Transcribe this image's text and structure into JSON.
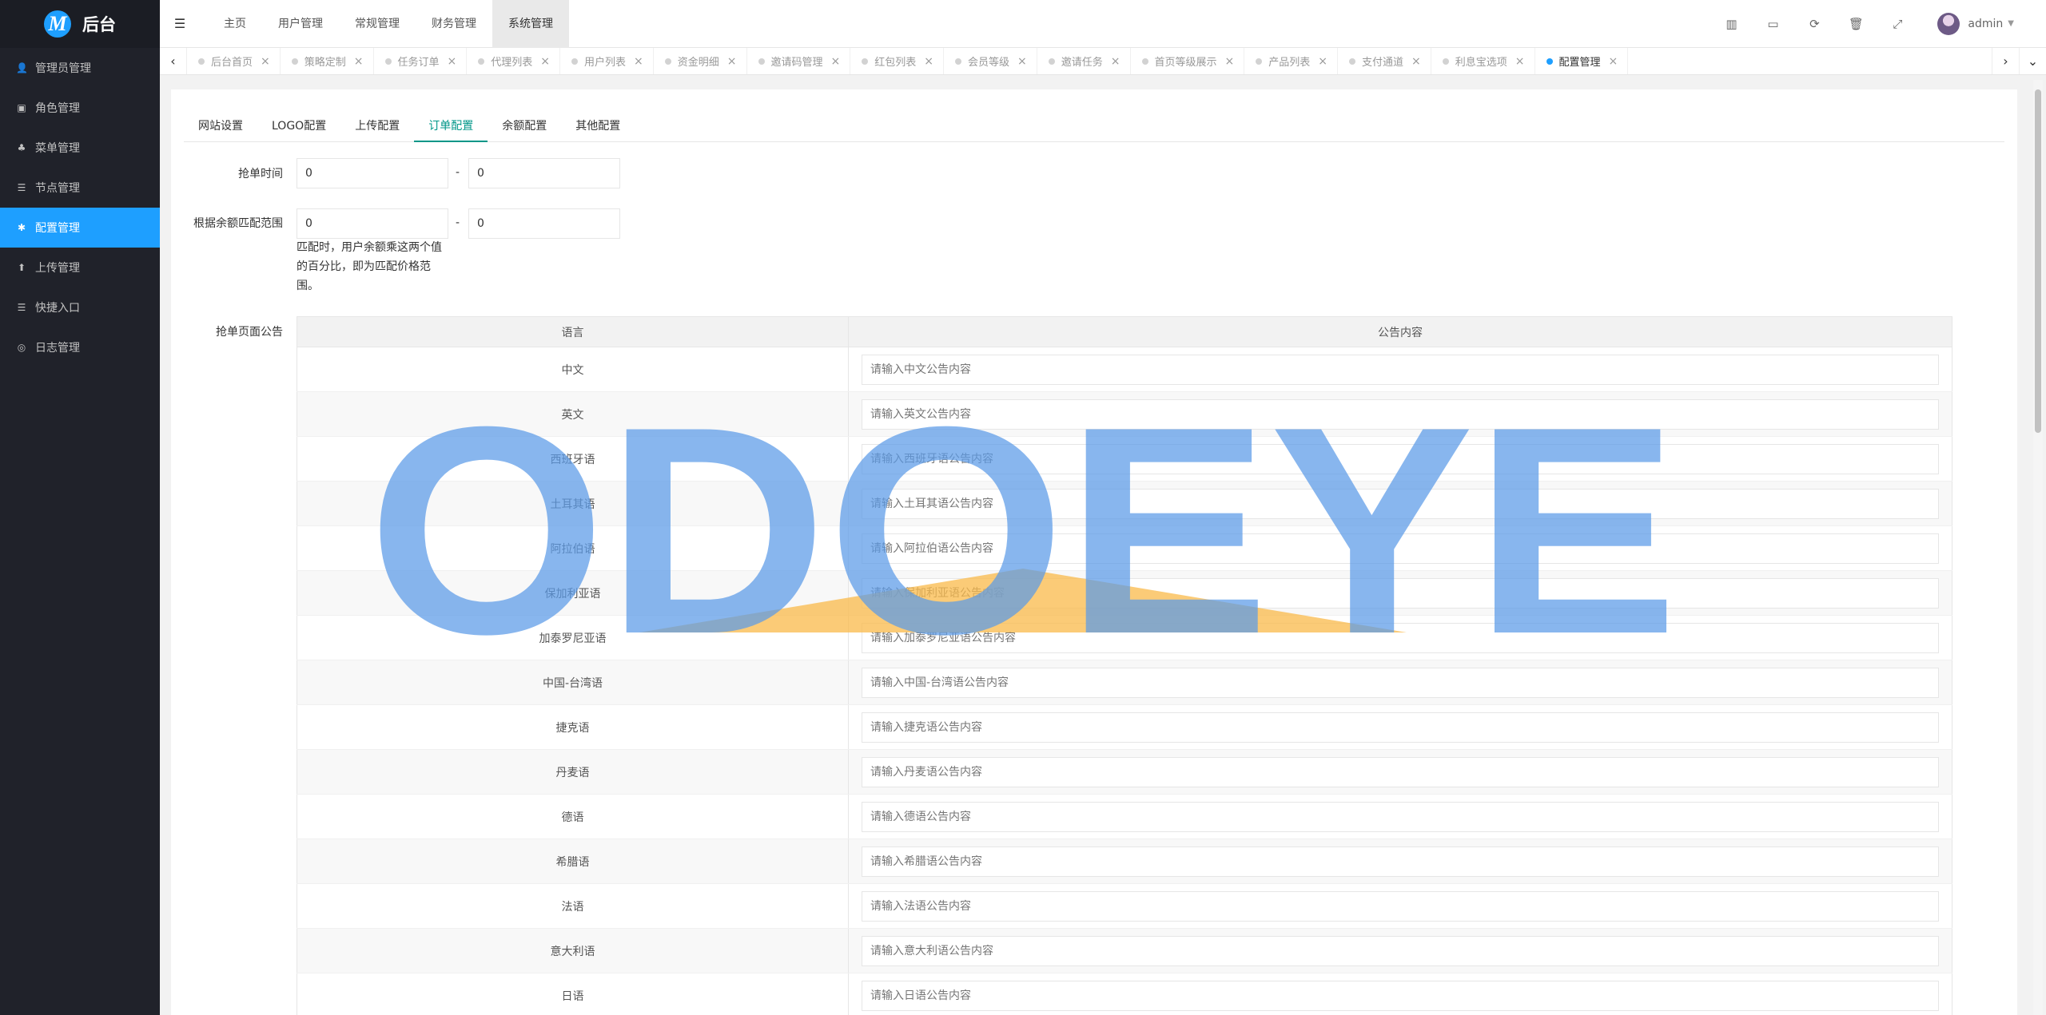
{
  "brand": {
    "logo_letter": "M",
    "name": "后台"
  },
  "sidebar": {
    "items": [
      {
        "icon": "user-icon",
        "glyph": "👤",
        "label": "管理员管理"
      },
      {
        "icon": "role-icon",
        "glyph": "▣",
        "label": "角色管理"
      },
      {
        "icon": "tree-icon",
        "glyph": "♣",
        "label": "菜单管理"
      },
      {
        "icon": "list-icon",
        "glyph": "☰",
        "label": "节点管理"
      },
      {
        "icon": "gear-icon",
        "glyph": "✱",
        "label": "配置管理"
      },
      {
        "icon": "upload-icon",
        "glyph": "⬆",
        "label": "上传管理"
      },
      {
        "icon": "list-icon",
        "glyph": "☰",
        "label": "快捷入口"
      },
      {
        "icon": "log-icon",
        "glyph": "◎",
        "label": "日志管理"
      }
    ],
    "active_index": 4
  },
  "header": {
    "toggle_glyph": "☰",
    "menu": [
      "主页",
      "用户管理",
      "常规管理",
      "财务管理",
      "系统管理"
    ],
    "active_menu": 4,
    "icons": [
      {
        "name": "chart-icon",
        "glyph": "▥"
      },
      {
        "name": "card-icon",
        "glyph": "▭"
      },
      {
        "name": "refresh-icon",
        "glyph": "⟳"
      },
      {
        "name": "trash-icon",
        "glyph": "🗑"
      },
      {
        "name": "fullscreen-icon",
        "glyph": "⤢"
      }
    ],
    "username": "admin"
  },
  "tabbar": {
    "tabs": [
      "后台首页",
      "策略定制",
      "任务订单",
      "代理列表",
      "用户列表",
      "资金明细",
      "邀请码管理",
      "红包列表",
      "会员等级",
      "邀请任务",
      "首页等级展示",
      "产品列表",
      "支付通道",
      "利息宝选项",
      "配置管理"
    ],
    "active_tab": 14,
    "close_glyph": "×"
  },
  "config": {
    "subtabs": [
      "网站设置",
      "LOGO配置",
      "上传配置",
      "订单配置",
      "余额配置",
      "其他配置"
    ],
    "active_subtab": 3,
    "grab_time": {
      "label": "抢单时间",
      "min": "0",
      "max": "0"
    },
    "balance_range": {
      "label": "根据余额匹配范围",
      "min": "0",
      "max": "0",
      "help": "匹配时，用户余额乘这两个值的百分比，即为匹配价格范围。"
    },
    "range_separator": "-",
    "announcement": {
      "label": "抢单页面公告",
      "col_lang": "语言",
      "col_content": "公告内容",
      "rows": [
        {
          "lang": "中文",
          "placeholder": "请输入中文公告内容"
        },
        {
          "lang": "英文",
          "placeholder": "请输入英文公告内容"
        },
        {
          "lang": "西班牙语",
          "placeholder": "请输入西班牙语公告内容"
        },
        {
          "lang": "土耳其语",
          "placeholder": "请输入土耳其语公告内容"
        },
        {
          "lang": "阿拉伯语",
          "placeholder": "请输入阿拉伯语公告内容"
        },
        {
          "lang": "保加利亚语",
          "placeholder": "请输入保加利亚语公告内容"
        },
        {
          "lang": "加泰罗尼亚语",
          "placeholder": "请输入加泰罗尼亚语公告内容"
        },
        {
          "lang": "中国-台湾语",
          "placeholder": "请输入中国-台湾语公告内容"
        },
        {
          "lang": "捷克语",
          "placeholder": "请输入捷克语公告内容"
        },
        {
          "lang": "丹麦语",
          "placeholder": "请输入丹麦语公告内容"
        },
        {
          "lang": "德语",
          "placeholder": "请输入德语公告内容"
        },
        {
          "lang": "希腊语",
          "placeholder": "请输入希腊语公告内容"
        },
        {
          "lang": "法语",
          "placeholder": "请输入法语公告内容"
        },
        {
          "lang": "意大利语",
          "placeholder": "请输入意大利语公告内容"
        },
        {
          "lang": "日语",
          "placeholder": "请输入日语公告内容"
        }
      ]
    }
  },
  "watermark": {
    "text": "ODOEYE",
    "text_color": "#5b9be8",
    "roof_color": "#f9b94a"
  }
}
